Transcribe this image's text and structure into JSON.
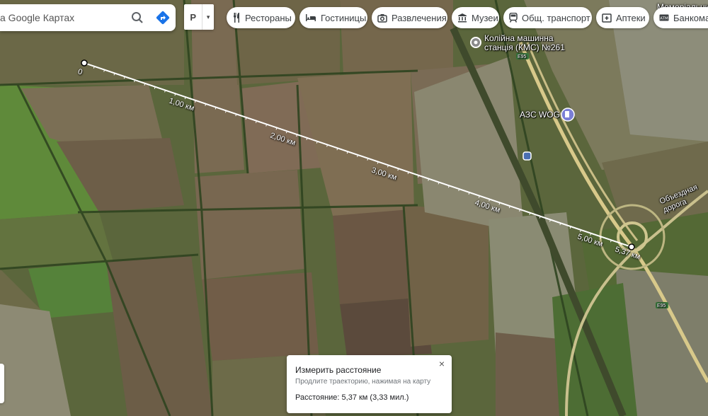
{
  "search": {
    "query": "а Google Картах",
    "search_icon": "search-icon",
    "directions_icon": "directions-icon"
  },
  "layers": {
    "label": "P",
    "arrow": "▾"
  },
  "chips": [
    {
      "label": "Рестораны",
      "icon": "restaurant-icon"
    },
    {
      "label": "Гостиницы",
      "icon": "hotel-icon"
    },
    {
      "label": "Развлечения",
      "icon": "camera-icon"
    },
    {
      "label": "Музеи",
      "icon": "museum-icon"
    },
    {
      "label": "Общ. транспорт",
      "icon": "transit-icon"
    },
    {
      "label": "Аптеки",
      "icon": "pharmacy-icon"
    },
    {
      "label": "Банкома",
      "icon": "atm-icon"
    }
  ],
  "places": {
    "station": "Колійна машинна станція (КМС) №261",
    "station_line1": "Колійна машинна",
    "station_line2": "станція (КМС) №261",
    "gas": "АЗС WOG",
    "memorial": "Меморіальний",
    "bypass": "Объездная дорога",
    "e95": "E95"
  },
  "measure": {
    "start_label": "0",
    "labels": [
      "1,00 км",
      "2,00 км",
      "3,00 км",
      "4,00 км",
      "5,00 км"
    ],
    "end_label": "5,37 км"
  },
  "panel": {
    "title": "Измерить расстояние",
    "subtitle": "Продлите траекторию, нажимая на карту",
    "distance": "Расстояние: 5,37 км (3,33 мил.)",
    "close": "×"
  },
  "colors": {
    "accent": "#1a73e8",
    "line": "#ffffff"
  }
}
